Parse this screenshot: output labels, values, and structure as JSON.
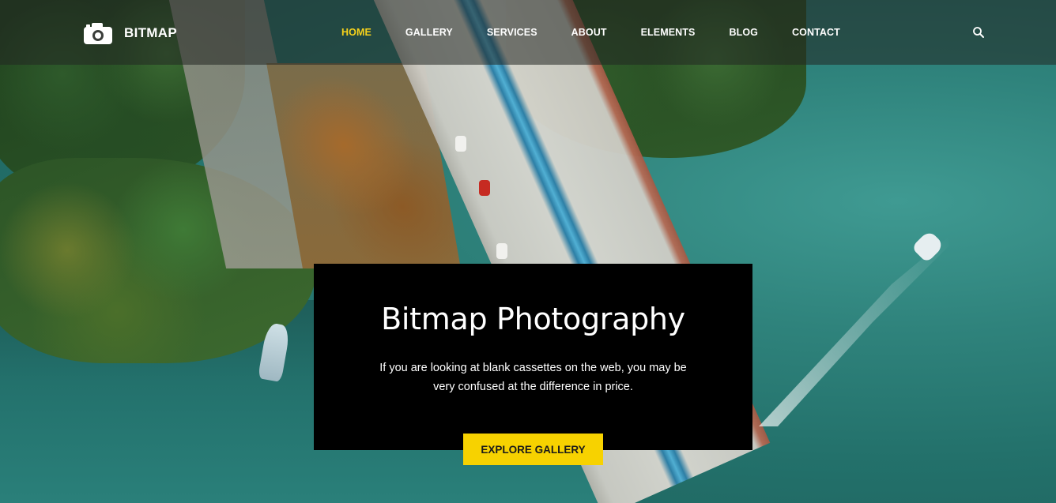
{
  "header": {
    "brand_name": "BITMAP",
    "brand_icon": "camera-icon",
    "nav": [
      {
        "label": "HOME",
        "active": true
      },
      {
        "label": "GALLERY",
        "active": false
      },
      {
        "label": "SERVICES",
        "active": false
      },
      {
        "label": "ABOUT",
        "active": false
      },
      {
        "label": "ELEMENTS",
        "active": false
      },
      {
        "label": "BLOG",
        "active": false
      },
      {
        "label": "CONTACT",
        "active": false
      }
    ],
    "search_icon": "search-icon"
  },
  "hero": {
    "title": "Bitmap Photography",
    "text_line1": "If you are looking at blank cassettes on the web, you may be",
    "text_line2": "very confused at the difference in price.",
    "cta_label": "EXPLORE GALLERY"
  },
  "colors": {
    "accent": "#f7d21b",
    "button": "#f7d200",
    "card": "#000000",
    "nav_text": "#ffffff"
  }
}
